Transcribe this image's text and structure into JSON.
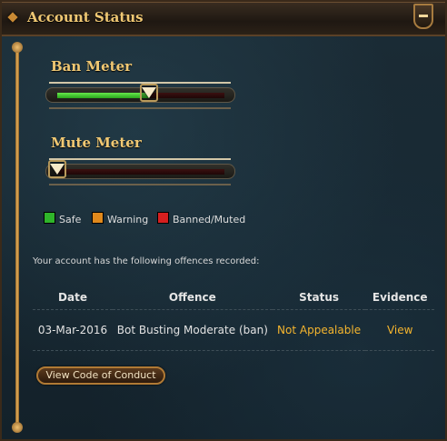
{
  "window": {
    "title": "Account Status",
    "collapse_icon": "minus-icon"
  },
  "ban_meter": {
    "label": "Ban Meter",
    "level": 0.55
  },
  "mute_meter": {
    "label": "Mute Meter",
    "level": 0.0
  },
  "legend": [
    {
      "label": "Safe",
      "color": "#2fb52a"
    },
    {
      "label": "Warning",
      "color": "#e0891c"
    },
    {
      "label": "Banned/Muted",
      "color": "#d61f1f"
    }
  ],
  "offences": {
    "intro": "Your account has the following offences recorded:",
    "columns": [
      "Date",
      "Offence",
      "Status",
      "Evidence"
    ],
    "rows": [
      {
        "date": "03-Mar-2016",
        "offence": "Bot Busting Moderate (ban)",
        "status": "Not Appealable",
        "evidence": "View"
      }
    ]
  },
  "buttons": {
    "code_of_conduct": "View Code of Conduct"
  },
  "colors": {
    "accent_gold": "#f0c873",
    "status_orange": "#f5b52e"
  }
}
